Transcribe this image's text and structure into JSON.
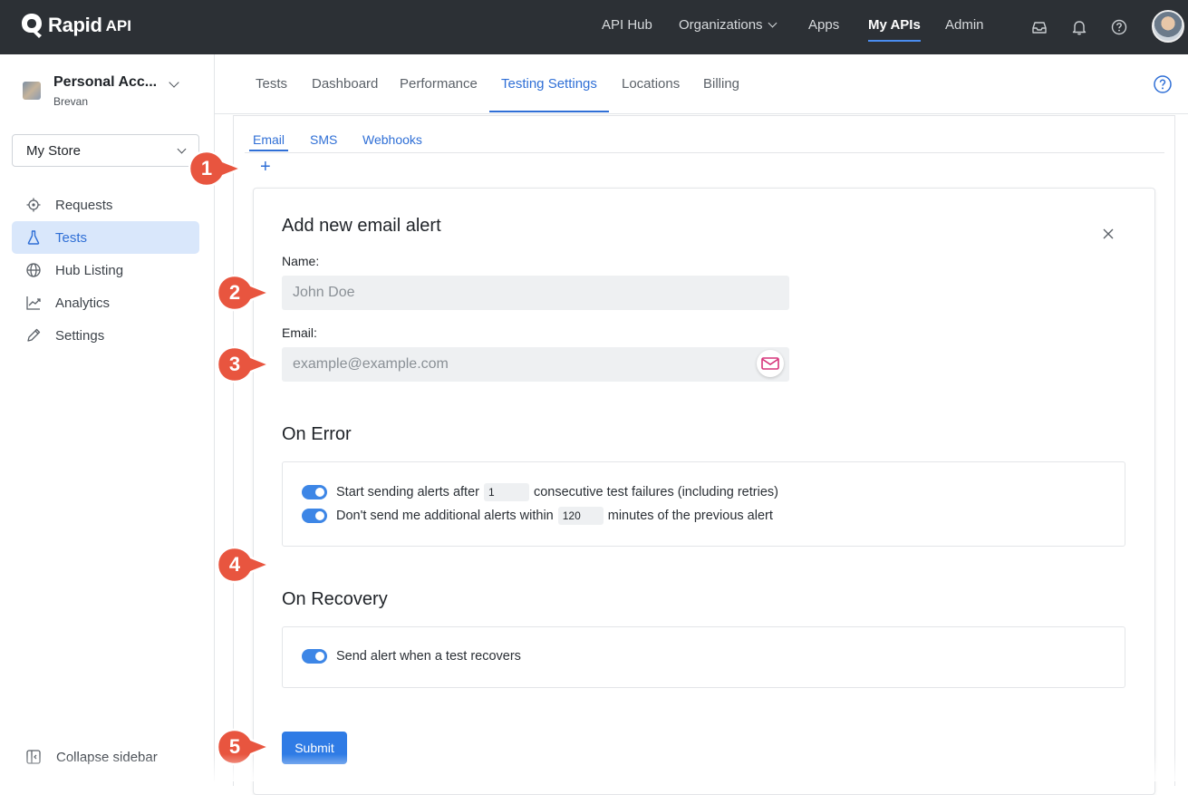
{
  "brand": {
    "name": "Rapid",
    "suffix": "API"
  },
  "topnav": {
    "items": [
      "API Hub",
      "Organizations",
      "Apps",
      "My APIs",
      "Admin"
    ],
    "active": "My APIs"
  },
  "account": {
    "name": "Personal Acc...",
    "sub": "Brevan"
  },
  "store_select": {
    "value": "My Store"
  },
  "sidebar": {
    "items": [
      {
        "label": "Requests",
        "icon": "requests-icon"
      },
      {
        "label": "Tests",
        "icon": "flask-icon",
        "active": true
      },
      {
        "label": "Hub Listing",
        "icon": "globe-icon"
      },
      {
        "label": "Analytics",
        "icon": "chart-line-icon"
      },
      {
        "label": "Settings",
        "icon": "pencil-icon"
      }
    ],
    "collapse_label": "Collapse sidebar"
  },
  "main_tabs": [
    "Tests",
    "Dashboard",
    "Performance",
    "Testing Settings",
    "Locations",
    "Billing"
  ],
  "main_tab_active": "Testing Settings",
  "sub_tabs": [
    "Email",
    "SMS",
    "Webhooks"
  ],
  "sub_tab_active": "Email",
  "add_button": "+",
  "form": {
    "title": "Add new email alert",
    "name_label": "Name:",
    "name_placeholder": "John Doe",
    "email_label": "Email:",
    "email_placeholder": "example@example.com",
    "on_error_title": "On Error",
    "error_row1_prefix": "Start sending alerts after",
    "error_row1_value": "1",
    "error_row1_suffix": "consecutive test failures (including retries)",
    "error_row2_prefix": "Don't send me additional alerts within",
    "error_row2_value": "120",
    "error_row2_suffix": "minutes of the previous alert",
    "on_recovery_title": "On Recovery",
    "recovery_row": "Send alert when a test recovers",
    "submit_label": "Submit"
  },
  "callouts": [
    "1",
    "2",
    "3",
    "4",
    "5"
  ],
  "colors": {
    "accent": "#2f6fd6",
    "topbar": "#2c3035",
    "callout": "#e8553f",
    "toggle": "#3d86e6"
  }
}
